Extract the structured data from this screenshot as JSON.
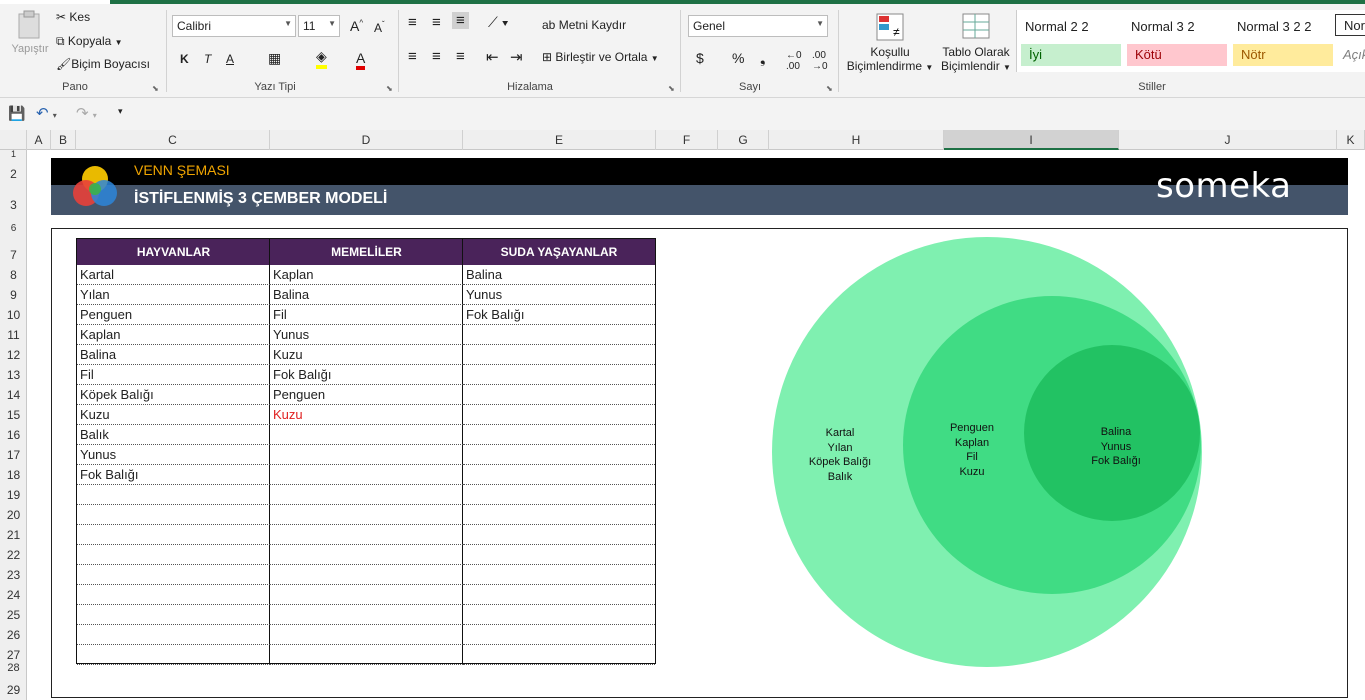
{
  "ribbon": {
    "clipboard": {
      "paste": "Yapıştır",
      "cut": "Kes",
      "copy": "Kopyala",
      "format_painter": "Biçim Boyacısı",
      "group": "Pano"
    },
    "font": {
      "name": "Calibri",
      "size": "11",
      "bold": "K",
      "italic": "T",
      "underline": "A",
      "group": "Yazı Tipi"
    },
    "alignment": {
      "wrap": "Metni Kaydır",
      "merge": "Birleştir ve Ortala",
      "group": "Hizalama"
    },
    "number": {
      "format": "Genel",
      "currency": "$",
      "percent": "%",
      "comma": "❟",
      "group": "Sayı"
    },
    "styles": {
      "conditional": [
        "Koşullu",
        "Biçimlendirme"
      ],
      "table": [
        "Tablo Olarak",
        "Biçimlendir"
      ],
      "cells": [
        "Normal 2 2",
        "Normal 3 2",
        "Normal 3 2 2",
        "Nor",
        "İyi",
        "Kötü",
        "Nötr",
        "Açık"
      ],
      "group": "Stiller"
    }
  },
  "columns": [
    "A",
    "B",
    "C",
    "D",
    "E",
    "F",
    "G",
    "H",
    "I",
    "J",
    "K"
  ],
  "rows": [
    "1",
    "2",
    "3",
    "6",
    "7",
    "8",
    "9",
    "10",
    "11",
    "12",
    "13",
    "14",
    "15",
    "16",
    "17",
    "18",
    "19",
    "20",
    "21",
    "22",
    "23",
    "24",
    "25",
    "26",
    "27",
    "28",
    "29"
  ],
  "banner": {
    "subtitle": "VENN ŞEMASI",
    "title": "İSTİFLENMİŞ 3 ÇEMBER MODELİ",
    "brand": "someka"
  },
  "table": {
    "headers": [
      "HAYVANLAR",
      "MEMELİLER",
      "SUDA YAŞAYANLAR"
    ],
    "col1": [
      "Kartal",
      "Yılan",
      "Penguen",
      "Kaplan",
      "Balina",
      "Fil",
      "Köpek Balığı",
      "Kuzu",
      "Balık",
      "Yunus",
      "Fok Balığı"
    ],
    "col2": [
      "Kaplan",
      "Balina",
      "Fil",
      "Yunus",
      "Kuzu",
      "Fok Balığı",
      "Penguen",
      "Kuzu"
    ],
    "col3": [
      "Balina",
      "Yunus",
      "Fok Balığı"
    ]
  },
  "venn": {
    "outer": [
      "Kartal",
      "Yılan",
      "Köpek Balığı",
      "Balık"
    ],
    "middle": [
      "Penguen",
      "Kaplan",
      "Fil",
      "Kuzu"
    ],
    "inner": [
      "Balina",
      "Yunus",
      "Fok Balığı"
    ],
    "colors": {
      "outer": "#7ff0b0",
      "middle": "#40dc84",
      "inner": "#22c263"
    }
  },
  "colors": {
    "header_bg": "#4a235a",
    "banner_top": "#000000",
    "banner_bottom": "#44546a",
    "subtitle": "#f0a500",
    "duplicate": "#e02020"
  }
}
